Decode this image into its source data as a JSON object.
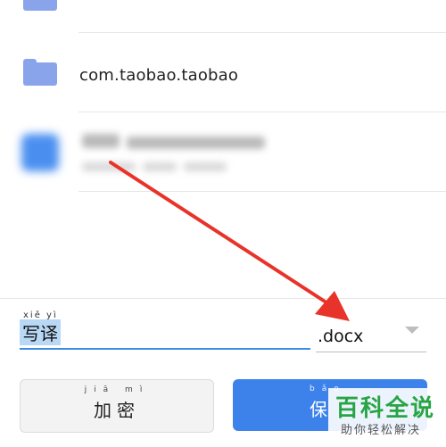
{
  "file_list": {
    "rows": [
      {
        "name": "",
        "icon": "folder-icon"
      },
      {
        "name": "com.taobao.taobao",
        "icon": "folder-icon"
      },
      {
        "name": "",
        "icon": "app-icon"
      }
    ]
  },
  "save_panel": {
    "file_name": "写译",
    "file_name_pinyin": "xiě yì",
    "extension": ".docx",
    "encrypt_label": "加密",
    "encrypt_pinyin": "jiā mì",
    "save_label": "保",
    "save_pinyin": "bǎo"
  },
  "watermark": {
    "title": "百科全说",
    "subtitle": "助你轻松解决"
  },
  "colors": {
    "accent": "#3c82ea",
    "arrow": "#e8332a",
    "folder": "#8aa4ec",
    "watermark_green": "#27a544"
  }
}
